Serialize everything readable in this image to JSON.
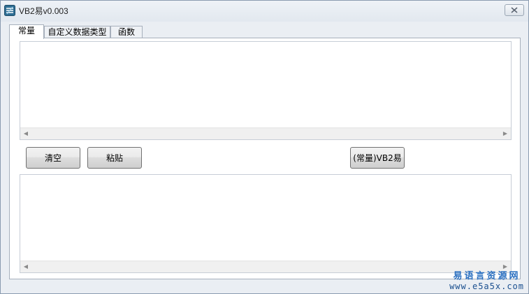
{
  "window": {
    "title": "VB2易v0.003",
    "icon": "app-icon",
    "close_icon": "close-icon"
  },
  "tabs": [
    {
      "label": "常量",
      "active": true
    },
    {
      "label": "自定义数据类型",
      "active": false
    },
    {
      "label": "函数",
      "active": false
    }
  ],
  "input_box": {
    "value": ""
  },
  "output_box": {
    "value": ""
  },
  "buttons": {
    "clear": "清空",
    "paste": "粘贴",
    "convert": "(常量)VB2易"
  },
  "watermark": {
    "cn": "易语言资源网",
    "url": "www.e5a5x.com"
  },
  "colors": {
    "window_bg": "#eaeef3",
    "watermark_blue": "#2a6fc0"
  }
}
